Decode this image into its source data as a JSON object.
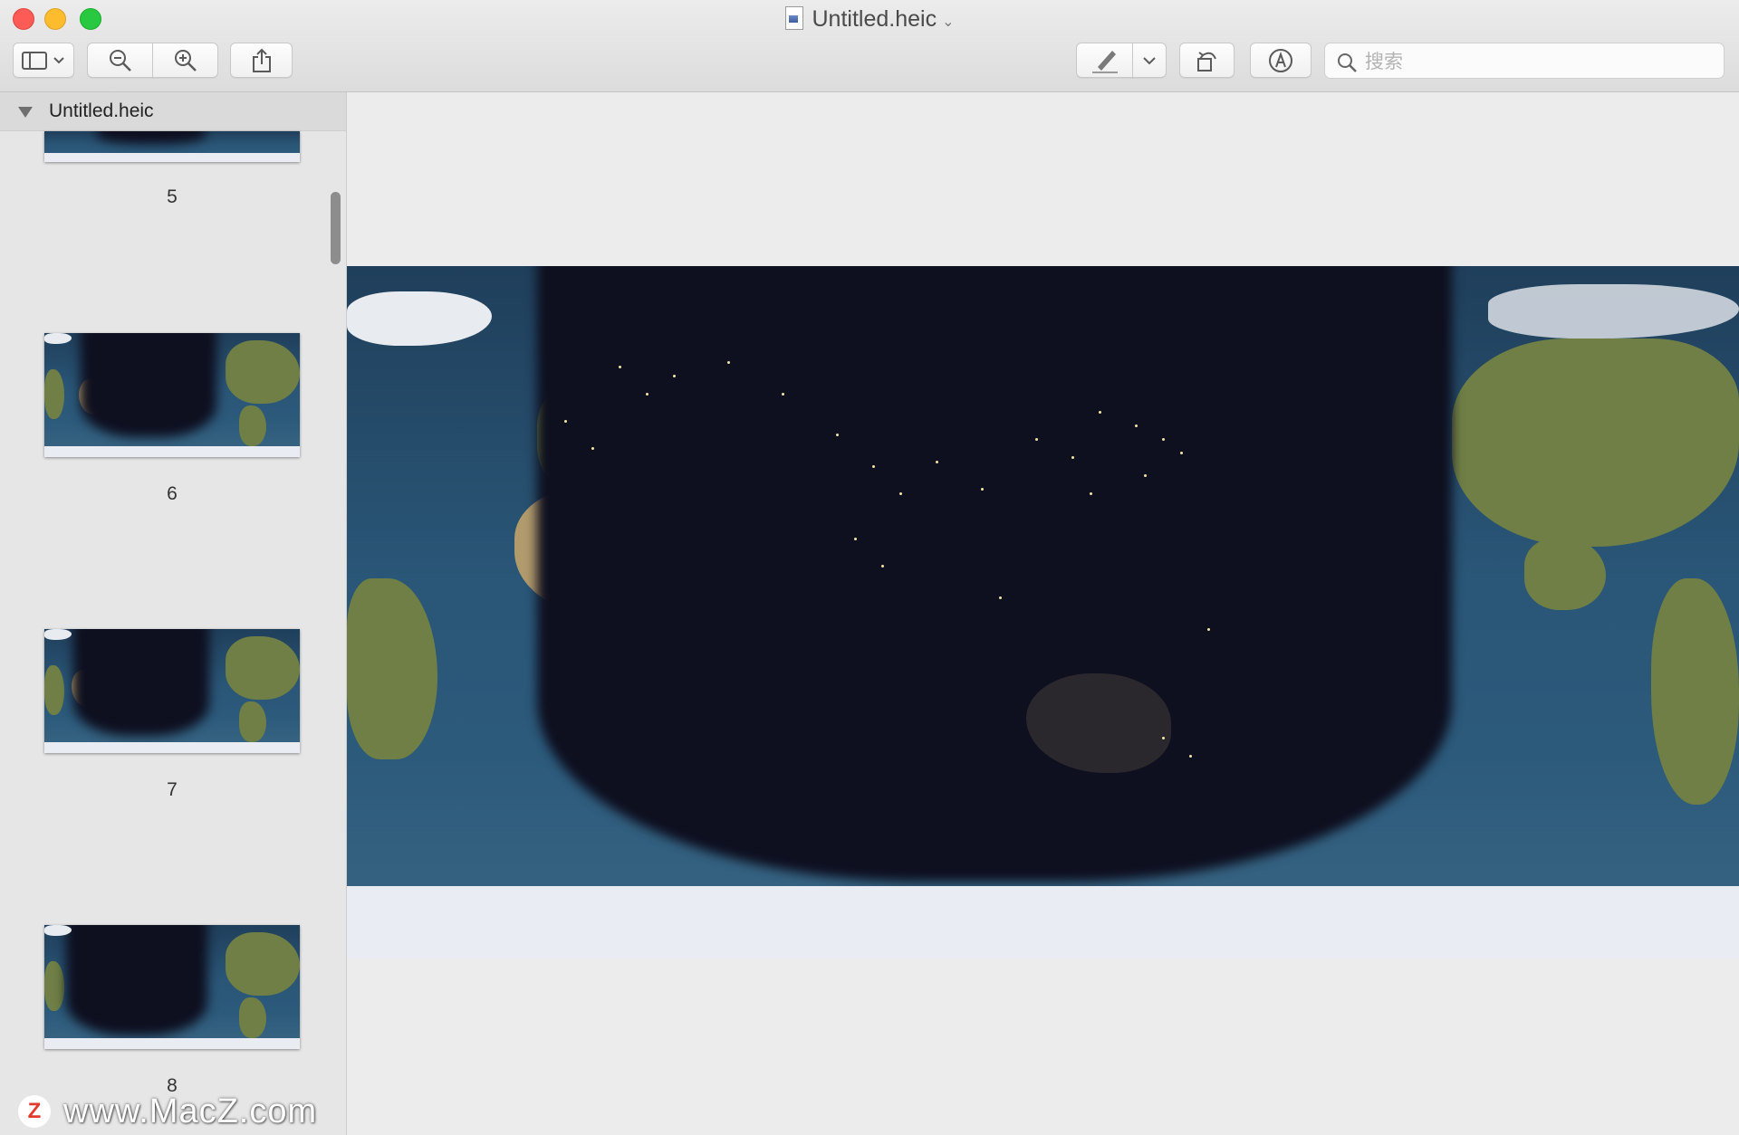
{
  "window": {
    "title": "Untitled.heic",
    "title_caret": "⌄",
    "traffic_lights": [
      "close",
      "minimize",
      "zoom"
    ]
  },
  "toolbar": {
    "buttons": [
      {
        "name": "sidebar-toggle",
        "icon": "sidebar-icon"
      },
      {
        "name": "zoom-out",
        "icon": "zoom-out-icon"
      },
      {
        "name": "zoom-in",
        "icon": "zoom-in-icon"
      },
      {
        "name": "share",
        "icon": "share-icon"
      },
      {
        "name": "highlight",
        "icon": "pen-icon"
      },
      {
        "name": "rotate",
        "icon": "rotate-icon"
      },
      {
        "name": "markup",
        "icon": "markup-icon"
      }
    ],
    "search_placeholder": "搜索"
  },
  "sidebar": {
    "header_label": "Untitled.heic",
    "pages": [
      {
        "number": "5"
      },
      {
        "number": "6"
      },
      {
        "number": "7"
      },
      {
        "number": "8"
      }
    ]
  },
  "watermark": {
    "logo_letter": "Z",
    "text": "www.MacZ.com"
  },
  "colors": {
    "close": "#fd5b56",
    "minimize": "#fdbc2e",
    "zoom": "#28c940",
    "night": "#0e0f1f",
    "ocean": "#2a5677"
  }
}
